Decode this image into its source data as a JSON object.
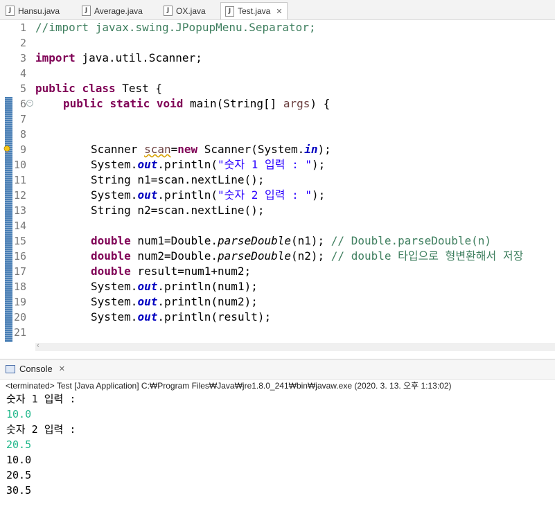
{
  "tabs": [
    {
      "label": "Hansu.java"
    },
    {
      "label": "Average.java"
    },
    {
      "label": "OX.java"
    },
    {
      "label": "Test.java",
      "active": true
    }
  ],
  "editor": {
    "line_numbers": [
      "1",
      "2",
      "3",
      "4",
      "5",
      "6",
      "7",
      "8",
      "9",
      "10",
      "11",
      "12",
      "13",
      "14",
      "15",
      "16",
      "17",
      "18",
      "19",
      "20",
      "21"
    ],
    "lines": {
      "l1": "//import javax.swing.JPopupMenu.Separator;",
      "l3_kw": "import",
      "l3_rest": " java.util.Scanner;",
      "l5_kw1": "public",
      "l5_kw2": "class",
      "l5_rest": " Test {",
      "l6_kw1": "public",
      "l6_kw2": "static",
      "l6_kw3": "void",
      "l6_rest1": " main(String[] ",
      "l6_var": "args",
      "l6_rest2": ") {",
      "l9_a": "Scanner ",
      "l9_var": "scan",
      "l9_b": "=",
      "l9_kw": "new",
      "l9_c": " Scanner(System.",
      "l9_fld": "in",
      "l9_d": ");",
      "l10_a": "System.",
      "l10_fld": "out",
      "l10_b": ".println(",
      "l10_str": "\"숫자 1 입력 : \"",
      "l10_c": ");",
      "l11": "String n1=scan.nextLine();",
      "l12_a": "System.",
      "l12_fld": "out",
      "l12_b": ".println(",
      "l12_str": "\"숫자 2 입력 : \"",
      "l12_c": ");",
      "l13": "String n2=scan.nextLine();",
      "l15_kw": "double",
      "l15_a": " num1=Double.",
      "l15_it": "parseDouble",
      "l15_b": "(n1); ",
      "l15_cm": "// Double.parseDouble(n)",
      "l16_kw": "double",
      "l16_a": " num2=Double.",
      "l16_it": "parseDouble",
      "l16_b": "(n2); ",
      "l16_cm": "// double 타입으로 형변환해서 저장",
      "l17_kw": "double",
      "l17_a": " result=num1+num2;",
      "l18_a": "System.",
      "l18_fld": "out",
      "l18_b": ".println(num1);",
      "l19_a": "System.",
      "l19_fld": "out",
      "l19_b": ".println(num2);",
      "l20_a": "System.",
      "l20_fld": "out",
      "l20_b": ".println(result);"
    }
  },
  "console": {
    "tab_label": "Console",
    "status": "<terminated> Test [Java Application] C:₩Program Files₩Java₩jre1.8.0_241₩bin₩javaw.exe (2020. 3. 13. 오후 1:13:02)",
    "output": [
      "숫자 1 입력 :",
      "10.0",
      "숫자 2 입력 :",
      "20.5",
      "10.0",
      "20.5",
      "30.5"
    ]
  },
  "colors": {
    "keyword": "#7f0055",
    "comment": "#3f7f5f",
    "string": "#2a00ff",
    "field": "#0000c0",
    "user_input": "#1fb78a"
  }
}
